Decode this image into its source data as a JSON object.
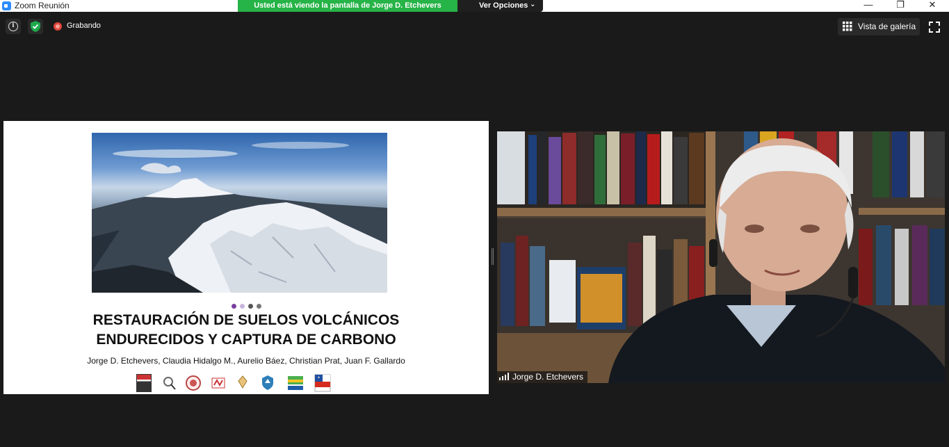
{
  "window": {
    "title": "Zoom Reunión",
    "minimize": "—",
    "restore": "❐",
    "close": "✕"
  },
  "share_banner": {
    "text": "Usted está viendo la pantalla de Jorge D. Etchevers"
  },
  "view_options": {
    "label": "Ver Opciones",
    "chevron": "⌄"
  },
  "toolbar": {
    "info_icon": "i",
    "recording_label": "Grabando",
    "gallery_label": "Vista de galería"
  },
  "slide": {
    "title_line1": "RESTAURACIÓN DE SUELOS VOLCÁNICOS",
    "title_line2": "ENDURECIDOS Y CAPTURA DE CARBONO",
    "authors": "Jorge D. Etchevers, Claudia Hidalgo M., Aurelio Báez, Christian Prat, Juan F. Gallardo",
    "dot_colors": [
      "#7b3fa0",
      "#c9b6dd",
      "#555555",
      "#777777"
    ]
  },
  "video": {
    "participant_name": "Jorge D. Etchevers"
  },
  "colors": {
    "banner_green": "#26b347",
    "background": "#1a1a1a",
    "record_red": "#e0463b",
    "shield_green": "#1ea94d"
  }
}
